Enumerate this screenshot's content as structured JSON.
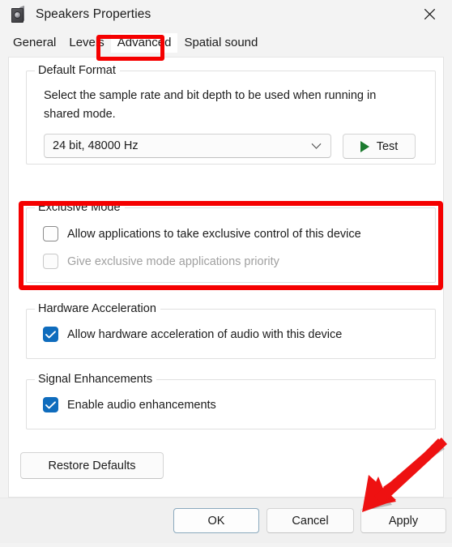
{
  "window": {
    "title": "Speakers Properties",
    "icon": "speaker-box-icon",
    "close_label": "Close"
  },
  "tabs": [
    {
      "label": "General",
      "selected": false
    },
    {
      "label": "Levels",
      "selected": false
    },
    {
      "label": "Advanced",
      "selected": true
    },
    {
      "label": "Spatial sound",
      "selected": false
    }
  ],
  "groups": {
    "default_format": {
      "legend": "Default Format",
      "description": "Select the sample rate and bit depth to be used when running in shared mode.",
      "combo_value": "24 bit, 48000 Hz",
      "combo_icon": "chevron-down-icon",
      "test_button": "Test",
      "test_icon": "play-icon"
    },
    "exclusive_mode": {
      "legend": "Exclusive Mode",
      "checkbox_allow_exclusive": {
        "label": "Allow applications to take exclusive control of this device",
        "checked": false,
        "disabled": false
      },
      "checkbox_priority": {
        "label": "Give exclusive mode applications priority",
        "checked": false,
        "disabled": true
      }
    },
    "hardware_acceleration": {
      "legend": "Hardware Acceleration",
      "checkbox": {
        "label": "Allow hardware acceleration of audio with this device",
        "checked": true,
        "disabled": false
      }
    },
    "signal_enhancements": {
      "legend": "Signal Enhancements",
      "checkbox": {
        "label": "Enable audio enhancements",
        "checked": true,
        "disabled": false
      }
    }
  },
  "buttons": {
    "restore_defaults": "Restore Defaults",
    "ok": "OK",
    "cancel": "Cancel",
    "apply": "Apply"
  },
  "annotations": {
    "highlight_color": "#f50000",
    "arrow_color": "#ee1111",
    "highlighted_tab": "Advanced",
    "highlighted_group": "Exclusive Mode",
    "arrow_target": "Apply"
  },
  "colors": {
    "accent": "#0f6cbd",
    "window_bg": "#f3f3f3",
    "panel_bg": "#ffffff",
    "footer_bg": "#f0f0f0",
    "play_green": "#1b7a2e",
    "default_button_border": "#8aa9bd"
  }
}
